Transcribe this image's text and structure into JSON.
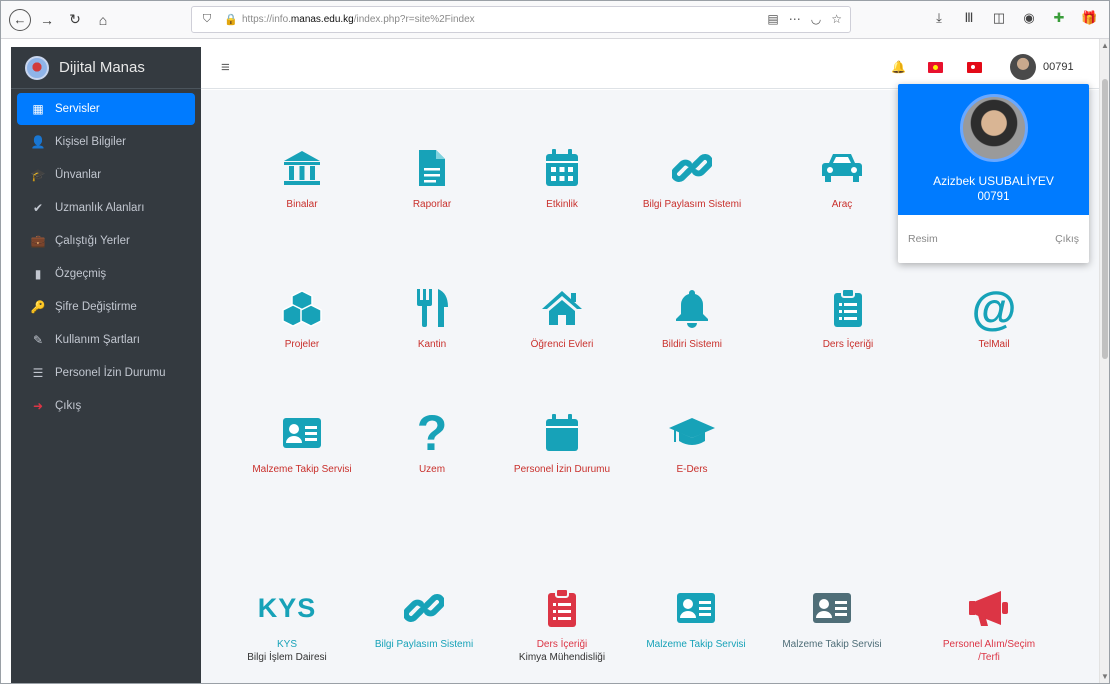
{
  "browser": {
    "url_prefix": "https://info.",
    "url_domain": "manas.edu.kg",
    "url_path": "/index.php?r=site%2Findex"
  },
  "sidebar": {
    "brand": "Dijital Manas",
    "items": [
      {
        "label": "Servisler",
        "icon": "grid-icon",
        "active": true
      },
      {
        "label": "Kişisel Bilgiler",
        "icon": "user-icon"
      },
      {
        "label": "Ünvanlar",
        "icon": "graduation-cap-icon"
      },
      {
        "label": "Uzmanlık Alanları",
        "icon": "check-icon"
      },
      {
        "label": "Çalıştığı Yerler",
        "icon": "briefcase-icon"
      },
      {
        "label": "Özgeçmiş",
        "icon": "file-icon"
      },
      {
        "label": "Şifre Değiştirme",
        "icon": "key-icon"
      },
      {
        "label": "Kullanım Şartları",
        "icon": "edit-icon"
      },
      {
        "label": "Personel İzin Durumu",
        "icon": "list-icon"
      },
      {
        "label": "Çıkış",
        "icon": "sign-out-icon"
      }
    ]
  },
  "header": {
    "user_code": "00791"
  },
  "tiles": [
    {
      "label": "Binalar",
      "icon": "building-icon"
    },
    {
      "label": "Raporlar",
      "icon": "document-icon"
    },
    {
      "label": "Etkinlik",
      "icon": "calendar-icon"
    },
    {
      "label": "Bilgi Paylasım Sistemi",
      "icon": "link-icon"
    },
    {
      "label": "Araç",
      "icon": "car-icon"
    },
    {
      "label": "Projeler",
      "icon": "cubes-icon"
    },
    {
      "label": "Kantin",
      "icon": "utensils-icon"
    },
    {
      "label": "Öğrenci Evleri",
      "icon": "home-icon"
    },
    {
      "label": "Bildiri Sistemi",
      "icon": "bell-icon"
    },
    {
      "label": "Ders İçeriği",
      "icon": "clipboard-icon"
    },
    {
      "label": "TelMail",
      "icon": "at-icon"
    },
    {
      "label": "Malzeme Takip Servisi",
      "icon": "id-card-icon"
    },
    {
      "label": "Uzem",
      "icon": "question-icon"
    },
    {
      "label": "Personel İzin Durumu",
      "icon": "calendar-blank-icon"
    },
    {
      "label": "E-Ders",
      "icon": "mortarboard-icon"
    },
    {
      "label": "KYS",
      "icon": "kys-text-icon",
      "sub": "Bilgi İşlem Dairesi",
      "mark": "KYS"
    },
    {
      "label": "Bilgi Paylasım Sistemi",
      "icon": "link-icon"
    },
    {
      "label": "Ders İçeriği",
      "icon": "clipboard-icon",
      "sub": "Kimya Mühendisliği"
    },
    {
      "label": "Malzeme Takip Servisi",
      "icon": "id-card-icon"
    },
    {
      "label": "Malzeme Takip Servisi",
      "icon": "id-card-icon"
    },
    {
      "label": "Personel Alım/Seçim /Terfi",
      "icon": "megaphone-icon"
    }
  ],
  "dropdown": {
    "name": "Azizbek USUBALİYEV",
    "code": "00791",
    "photo_button": "Resim",
    "logout_button": "Çıkış"
  },
  "colors": {
    "accent": "#007bff",
    "icon_teal": "#17a2b8",
    "label_red": "#c9302c",
    "sidebar_bg": "#343a40"
  }
}
